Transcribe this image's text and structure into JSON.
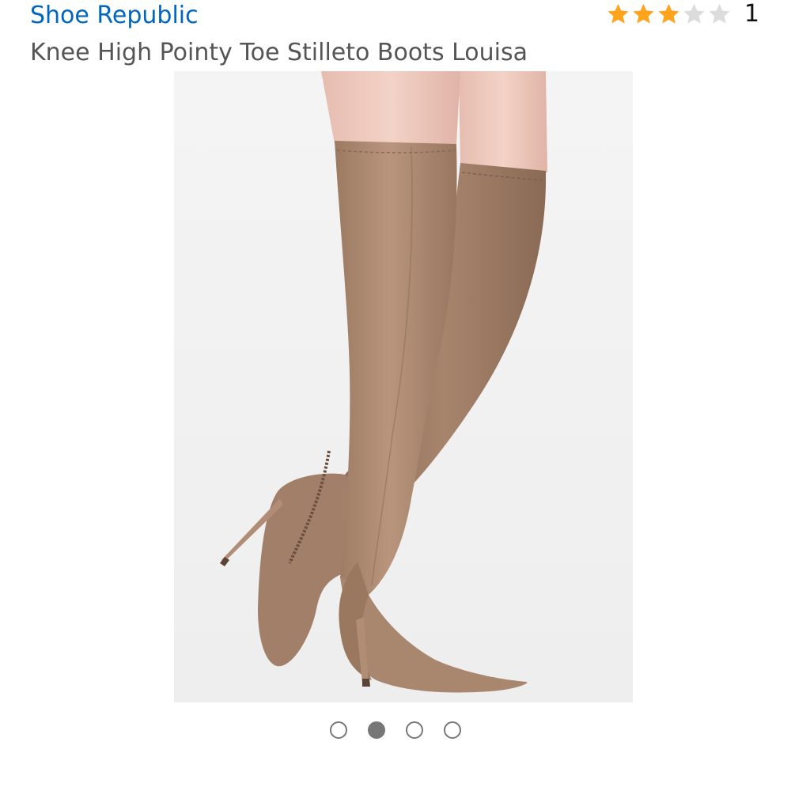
{
  "product": {
    "brand": "Shoe Republic",
    "title": "Knee High Pointy Toe Stilleto Boots Louisa",
    "rating": 3,
    "rating_max": 5,
    "review_count": "1",
    "image_icon": "product-photo-boots"
  },
  "carousel": {
    "total": 4,
    "active_index": 1
  },
  "colors": {
    "brand_link": "#0066c0",
    "star_filled": "#ffa41c",
    "star_empty": "#dcdcdc",
    "title_text": "#555555",
    "boot_suede": "#ad8b73",
    "image_bg": "#f1f1f1",
    "dot_border": "#777777"
  }
}
